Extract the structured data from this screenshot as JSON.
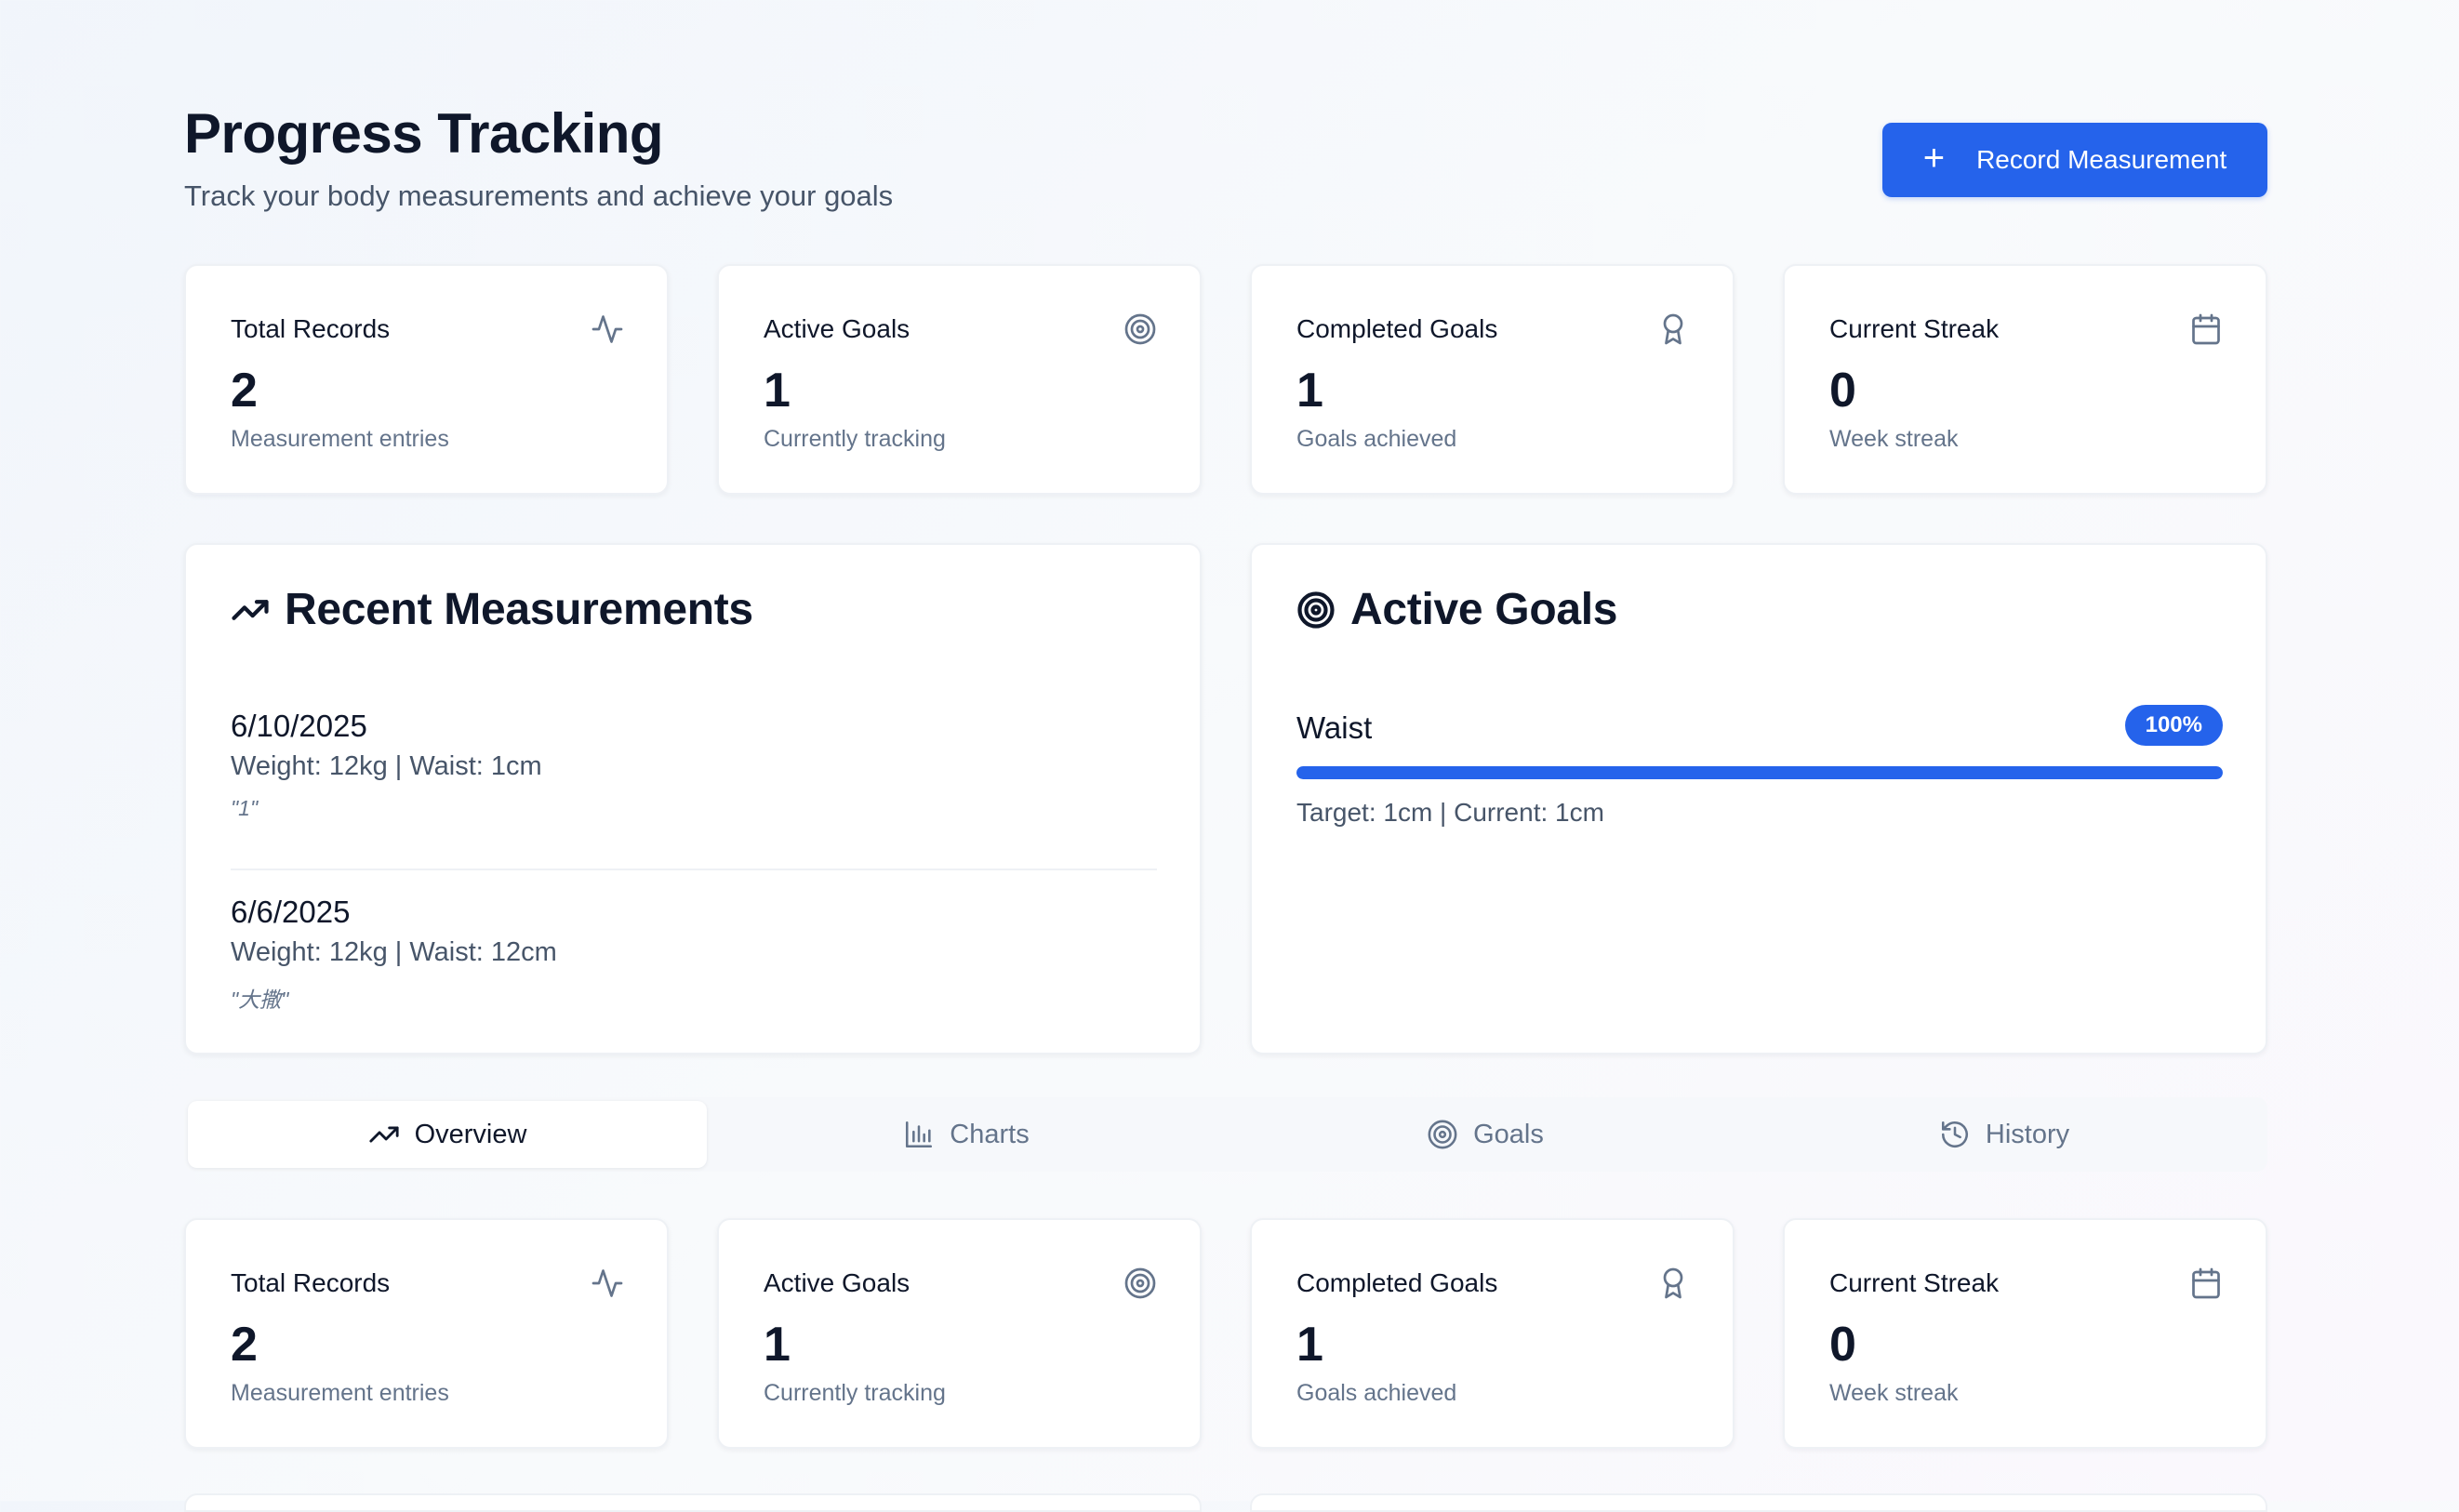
{
  "header": {
    "title": "Progress Tracking",
    "subtitle": "Track your body measurements and achieve your goals",
    "record_button_label": "Record Measurement"
  },
  "stats": [
    {
      "label": "Total Records",
      "value": "2",
      "desc": "Measurement entries",
      "icon": "activity-icon"
    },
    {
      "label": "Active Goals",
      "value": "1",
      "desc": "Currently tracking",
      "icon": "target-icon"
    },
    {
      "label": "Completed Goals",
      "value": "1",
      "desc": "Goals achieved",
      "icon": "award-icon"
    },
    {
      "label": "Current Streak",
      "value": "0",
      "desc": "Week streak",
      "icon": "calendar-icon"
    }
  ],
  "recent_measurements": {
    "title": "Recent Measurements",
    "items": [
      {
        "date": "6/10/2025",
        "stats": "Weight: 12kg | Waist: 1cm",
        "note": "\"1\""
      },
      {
        "date": "6/6/2025",
        "stats": "Weight: 12kg | Waist: 12cm",
        "note": "\"大撒\""
      }
    ]
  },
  "active_goals": {
    "title": "Active Goals",
    "items": [
      {
        "name": "Waist",
        "percent_label": "100%",
        "progress": 1.0,
        "detail": "Target: 1cm | Current: 1cm"
      }
    ]
  },
  "tabs": [
    {
      "label": "Overview",
      "icon": "trending-up-icon",
      "active": true
    },
    {
      "label": "Charts",
      "icon": "bar-chart-icon",
      "active": false
    },
    {
      "label": "Goals",
      "icon": "target-icon",
      "active": false
    },
    {
      "label": "History",
      "icon": "history-icon",
      "active": false
    }
  ],
  "colors": {
    "accent": "#2563eb",
    "text": "#0f172a",
    "muted": "#64748b"
  }
}
